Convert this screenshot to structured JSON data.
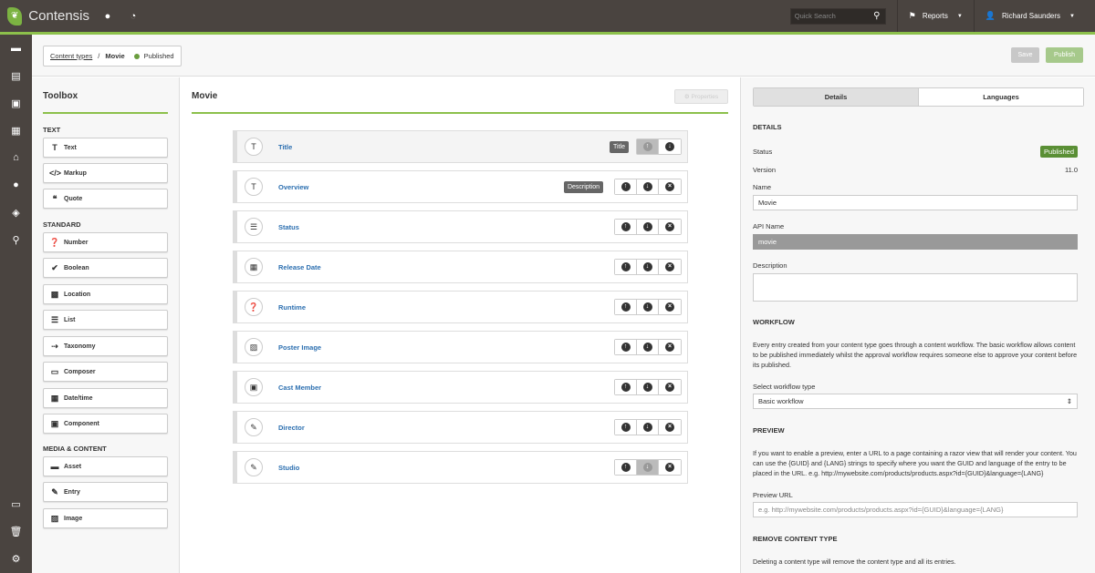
{
  "app": {
    "name": "Contensis"
  },
  "topbar": {
    "search_placeholder": "Quick Search",
    "reports_label": "Reports",
    "user_label": "Richard Saunders"
  },
  "breadcrumb": {
    "parent": "Content types",
    "separator": "/",
    "current": "Movie",
    "status": "Published"
  },
  "actions": {
    "save_label": "Save",
    "publish_label": "Publish"
  },
  "toolbox": {
    "title": "Toolbox",
    "sections": [
      {
        "label": "TEXT",
        "items": [
          {
            "label": "Text",
            "icon": "text-icon"
          },
          {
            "label": "Markup",
            "icon": "code-icon"
          },
          {
            "label": "Quote",
            "icon": "quote-icon"
          }
        ]
      },
      {
        "label": "STANDARD",
        "items": [
          {
            "label": "Number",
            "icon": "number-icon"
          },
          {
            "label": "Boolean",
            "icon": "check-icon"
          },
          {
            "label": "Location",
            "icon": "location-icon"
          },
          {
            "label": "List",
            "icon": "list-icon"
          },
          {
            "label": "Taxonomy",
            "icon": "taxonomy-icon"
          },
          {
            "label": "Composer",
            "icon": "composer-icon"
          },
          {
            "label": "Date/time",
            "icon": "calendar-icon"
          },
          {
            "label": "Component",
            "icon": "component-icon"
          }
        ]
      },
      {
        "label": "MEDIA & CONTENT",
        "items": [
          {
            "label": "Asset",
            "icon": "asset-icon"
          },
          {
            "label": "Entry",
            "icon": "entry-icon"
          },
          {
            "label": "Image",
            "icon": "image-icon"
          }
        ]
      }
    ]
  },
  "editor": {
    "title": "Movie",
    "properties_label": "Properties",
    "fields": [
      {
        "name": "Title",
        "icon": "text-icon",
        "badge": "Title"
      },
      {
        "name": "Overview",
        "icon": "text-icon",
        "badge": "Description"
      },
      {
        "name": "Status",
        "icon": "list-icon",
        "badge": ""
      },
      {
        "name": "Release Date",
        "icon": "calendar-icon",
        "badge": ""
      },
      {
        "name": "Runtime",
        "icon": "number-icon",
        "badge": ""
      },
      {
        "name": "Poster Image",
        "icon": "image-icon",
        "badge": ""
      },
      {
        "name": "Cast Member",
        "icon": "component-icon",
        "badge": ""
      },
      {
        "name": "Director",
        "icon": "entry-icon",
        "badge": ""
      },
      {
        "name": "Studio",
        "icon": "entry-icon",
        "badge": ""
      }
    ]
  },
  "panel": {
    "tabs": {
      "details": "Details",
      "languages": "Languages"
    },
    "details_heading": "DETAILS",
    "status_label": "Status",
    "status_value": "Published",
    "version_label": "Version",
    "version_value": "11.0",
    "name_label": "Name",
    "name_value": "Movie",
    "api_label": "API Name",
    "api_value": "movie",
    "description_label": "Description",
    "workflow_heading": "WORKFLOW",
    "workflow_text": "Every entry created from your content type goes through a content workflow. The basic workflow allows content to be published immediately whilst the approval workflow requires someone else to approve your content before its published.",
    "workflow_select_label": "Select workflow type",
    "workflow_select_value": "Basic workflow",
    "preview_heading": "PREVIEW",
    "preview_text": "If you want to enable a preview, enter a URL to a page containing a razor view that will render your content. You can use the {GUID} and {LANG} strings to specify where you want the GUID and language of the entry to be placed in the URL.  e.g. http://mywebsite.com/products/products.aspx?id={GUID}&language={LANG}",
    "preview_url_label": "Preview URL",
    "preview_url_placeholder": "e.g. http://mywebsite.com/products/products.aspx?id={GUID}&language={LANG}",
    "remove_heading": "REMOVE CONTENT TYPE",
    "remove_text": "Deleting a content type will remove the content type and all its entries."
  }
}
